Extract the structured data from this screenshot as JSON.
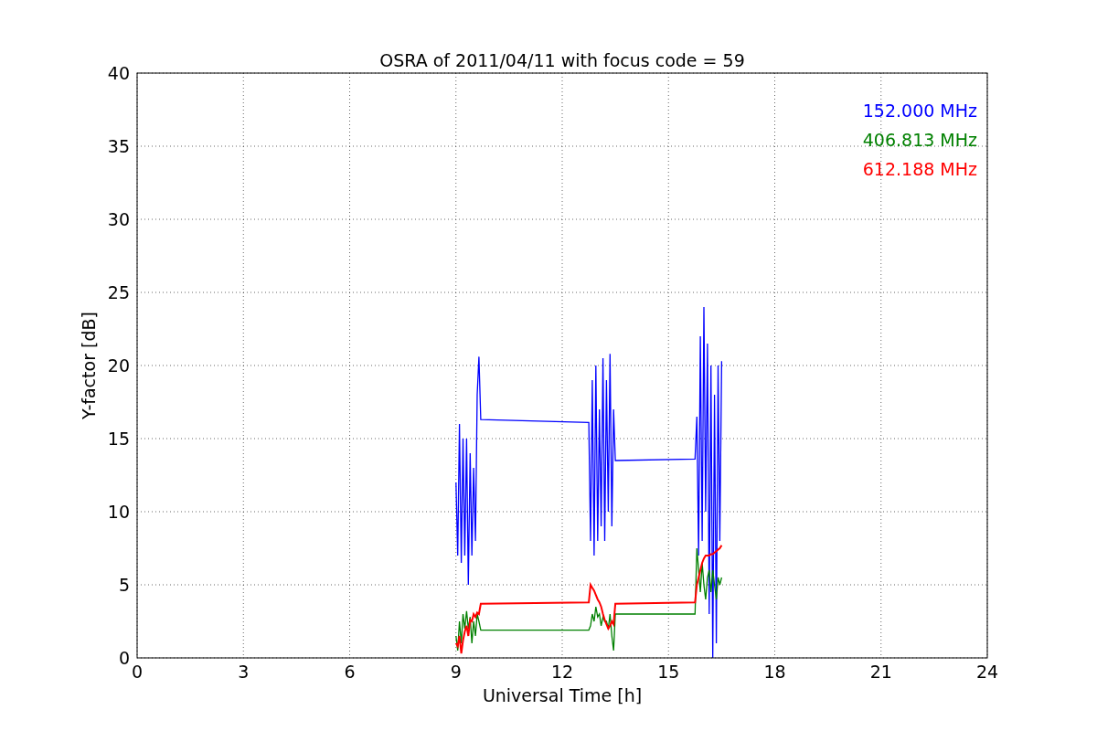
{
  "chart_data": {
    "type": "line",
    "title": "OSRA of 2011/04/11 with focus code = 59",
    "xlabel": "Universal Time [h]",
    "ylabel": "Y-factor [dB]",
    "x": [
      9.0,
      9.05,
      9.1,
      9.15,
      9.2,
      9.25,
      9.3,
      9.35,
      9.4,
      9.45,
      9.5,
      9.55,
      9.6,
      9.65,
      9.7,
      12.75,
      12.8,
      12.85,
      12.9,
      12.95,
      13.0,
      13.05,
      13.1,
      13.15,
      13.2,
      13.25,
      13.3,
      13.35,
      13.4,
      13.45,
      13.5,
      15.75,
      15.8,
      15.85,
      15.9,
      15.95,
      16.0,
      16.05,
      16.1,
      16.15,
      16.2,
      16.25,
      16.3,
      16.35,
      16.4,
      16.45,
      16.5
    ],
    "series": [
      {
        "name": "152.000 MHz",
        "color": "#0000ff",
        "values": [
          12,
          7,
          16,
          6.5,
          15,
          7,
          15,
          5,
          14,
          7,
          13,
          8,
          18,
          20.6,
          16.3,
          16.1,
          8,
          19,
          7,
          20,
          8,
          17,
          9,
          20.5,
          8,
          19,
          10,
          20.8,
          9,
          17,
          13.5,
          13.6,
          16.5,
          7,
          22,
          8,
          24,
          10,
          21.5,
          3,
          20,
          0,
          18,
          1,
          20,
          8,
          20.3
        ]
      },
      {
        "name": "406.813 MHz",
        "color": "#008000",
        "values": [
          1.5,
          0.5,
          2.5,
          1,
          3,
          2,
          3.2,
          2,
          2.8,
          1,
          2.5,
          1.5,
          3,
          2.5,
          1.9,
          1.9,
          2.2,
          3,
          2.5,
          3.5,
          2.8,
          3,
          2.2,
          2.8,
          2.5,
          2.5,
          2,
          3,
          1.5,
          0.5,
          3,
          3.0,
          7.5,
          6,
          4.5,
          6.5,
          5,
          4,
          5.5,
          6,
          4.5,
          6,
          5,
          4,
          5.5,
          5,
          5.5
        ]
      },
      {
        "name": "612.188 MHz",
        "color": "#ff0000",
        "values": [
          1,
          0.8,
          1.5,
          0.3,
          1.2,
          1.8,
          2.2,
          1.5,
          2.6,
          2.5,
          3,
          2.8,
          3.1,
          3,
          3.7,
          3.8,
          5,
          4.8,
          4.6,
          4.3,
          4.0,
          3.8,
          3.5,
          3.0,
          2.6,
          2.3,
          2.0,
          2.2,
          2.5,
          2.3,
          3.7,
          3.8,
          5,
          5.5,
          6,
          6.5,
          6.8,
          7,
          7,
          7,
          7.1,
          7.1,
          7.2,
          7.3,
          7.4,
          7.5,
          7.7
        ]
      }
    ],
    "grid": true,
    "xlim": [
      0,
      24
    ],
    "ylim": [
      0,
      40
    ],
    "xticks": [
      0,
      3,
      6,
      9,
      12,
      15,
      18,
      21,
      24
    ],
    "yticks": [
      0,
      5,
      10,
      15,
      20,
      25,
      30,
      35,
      40
    ]
  }
}
